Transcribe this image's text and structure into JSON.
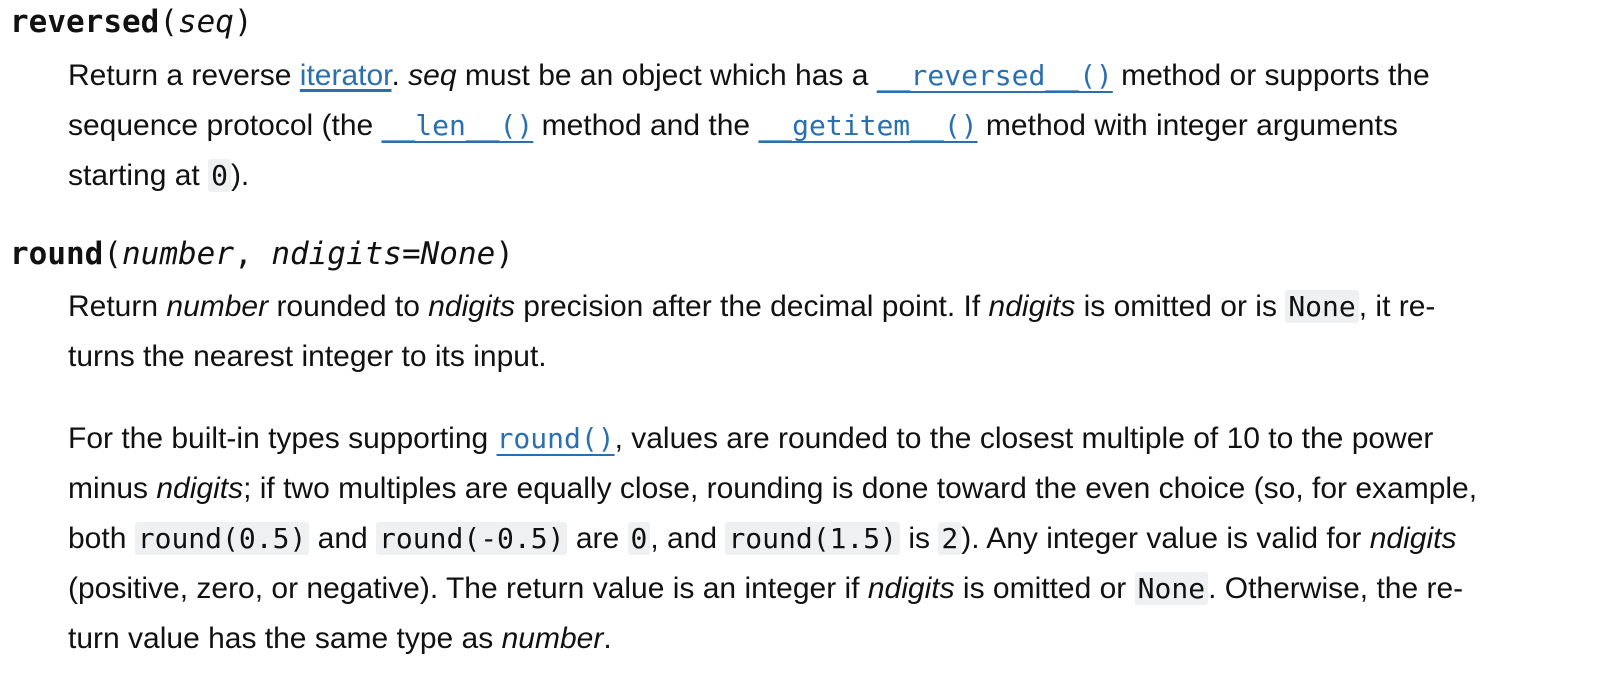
{
  "reversed": {
    "name": "reversed",
    "param": "seq",
    "desc": {
      "t1": "Return a reverse ",
      "link_iterator": "iterator",
      "t2": ". ",
      "seq": "seq",
      "t3": " must be an object which has a ",
      "code_reversed": "__reversed__()",
      "t4": " method or supports the",
      "t5": "sequence protocol (the ",
      "code_len": "__len__()",
      "t6": " method and the ",
      "code_getitem": "__getitem__()",
      "t7": " method with integer arguments",
      "t8": "starting at ",
      "code_zero": "0",
      "t9": ")."
    }
  },
  "round": {
    "name": "round",
    "param_number": "number",
    "param_ndigits": "ndigits=None",
    "p1": {
      "t1": "Return ",
      "number": "number",
      "t2": " rounded to ",
      "ndigits": "ndigits",
      "t3": " precision after the decimal point. If ",
      "t4": " is omitted or is ",
      "code_none": "None",
      "t5": ", it re-",
      "t6": "turns the nearest integer to its input."
    },
    "p2": {
      "t1": "For the built-in types supporting ",
      "code_round": "round()",
      "t2": ", values are rounded to the closest multiple of 10 to the power",
      "t3": "minus ",
      "ndigits": "ndigits",
      "t4": "; if two multiples are equally close, rounding is done toward the even choice (so, for example,",
      "t5": "both ",
      "code_r05": "round(0.5)",
      "t6": " and ",
      "code_rm05": "round(-0.5)",
      "t7": " are ",
      "code_zero": "0",
      "t8": ", and ",
      "code_r15": "round(1.5)",
      "t9": " is ",
      "code_two": "2",
      "t10": "). Any integer value is valid for ",
      "t11": "(positive, zero, or negative). The return value is an integer if ",
      "t12": " is omitted or ",
      "code_none": "None",
      "t13": ". Otherwise, the re-",
      "t14": "turn value has the same type as ",
      "number": "number",
      "t15": "."
    }
  }
}
